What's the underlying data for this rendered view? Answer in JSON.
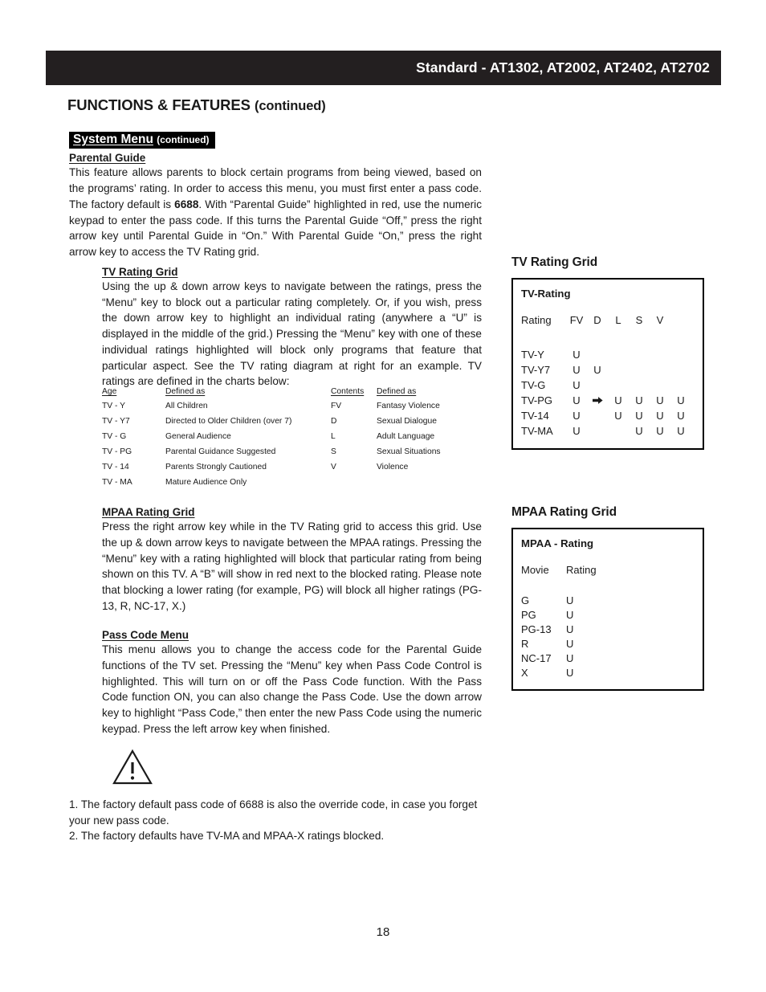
{
  "header": {
    "model_line": "Standard - AT1302, AT2002, AT2402, AT2702"
  },
  "page_title": {
    "main": "FUNCTIONS & FEATURES",
    "continued": "(continued)"
  },
  "section": {
    "badge_main": "System Menu",
    "badge_sub": "(continued)"
  },
  "parental_guide": {
    "heading": "Parental Guide",
    "paragraph": "This feature allows parents to block certain programs from being viewed, based on the programs’ rating. In order to access this menu, you must first enter a pass code. The factory default is ",
    "bold_code": "6688",
    "paragraph_rest": ". With “Parental Guide” highlighted in red, use the numeric keypad to enter the pass code. If this turns the Parental Guide “Off,” press the right arrow key until Parental Guide in “On.” With Parental Guide “On,” press the right arrow key to access the TV Rating grid."
  },
  "tv_rating_grid_text": {
    "heading": "TV Rating Grid",
    "paragraph": "Using the up & down arrow keys to navigate between the ratings, press the “Menu” key to block out a particular rating completely. Or, if you wish, press the down arrow key to highlight an individual rating (anywhere a “U” is displayed in the middle of the grid.) Pressing the “Menu” key with one of these individual ratings highlighted will block only programs that feature that particular aspect. See the TV rating diagram at right for an example. TV ratings are defined in the charts below:"
  },
  "age_chart": {
    "headers": [
      "Age",
      "Defined as"
    ],
    "rows": [
      [
        "TV - Y",
        "All Children"
      ],
      [
        "TV - Y7",
        "Directed to Older Children (over 7)"
      ],
      [
        "TV - G",
        "General Audience"
      ],
      [
        "TV - PG",
        "Parental Guidance Suggested"
      ],
      [
        "TV - 14",
        "Parents Strongly Cautioned"
      ],
      [
        "TV - MA",
        "Mature Audience Only"
      ]
    ]
  },
  "contents_chart": {
    "headers": [
      "Contents",
      "Defined as"
    ],
    "rows": [
      [
        "FV",
        "Fantasy Violence"
      ],
      [
        "D",
        "Sexual Dialogue"
      ],
      [
        "L",
        "Adult Language"
      ],
      [
        "S",
        "Sexual Situations"
      ],
      [
        "V",
        "Violence"
      ]
    ]
  },
  "mpaa_rating_grid_text": {
    "heading": "MPAA Rating Grid",
    "paragraph": "Press the right arrow key while in the TV Rating grid to access this grid. Use the up & down arrow keys to navigate between the MPAA ratings. Pressing the “Menu” key with a rating highlighted will block that particular rating from being shown on this TV. A “B” will show in red next to the blocked rating. Please note that blocking a lower rating (for example, PG) will block all higher ratings (PG-13, R, NC-17, X.)"
  },
  "pass_code_menu": {
    "heading": "Pass Code Menu",
    "paragraph": "This menu allows you to change the access code for the Parental Guide functions of the TV set. Pressing the “Menu” key when Pass Code Control is highlighted. This will turn on or off the Pass Code function. With the Pass Code function ON, you can also change the Pass Code. Use the down arrow key to highlight “Pass Code,” then enter the new Pass Code using the numeric keypad. Press the left arrow key when finished."
  },
  "notes": {
    "note1": "1. The factory default pass code of 6688 is also the override code, in case you forget your new pass code.",
    "note2": "2. The factory defaults have TV-MA and MPAA-X ratings blocked."
  },
  "tv_grid": {
    "title": "TV Rating Grid",
    "box_title": "TV-Rating",
    "column_header_label": "Rating",
    "columns": [
      "FV",
      "D",
      "L",
      "S",
      "V"
    ],
    "cursor_icon": "right-arrow-cursor-icon",
    "rows": [
      {
        "label": "TV-Y",
        "cells": [
          "U",
          "",
          "",
          "",
          ""
        ],
        "cursor_col": -1
      },
      {
        "label": "TV-Y7",
        "cells": [
          "U",
          "U",
          "",
          "",
          ""
        ],
        "cursor_col": -1
      },
      {
        "label": "TV-G",
        "cells": [
          "U",
          "",
          "",
          "",
          ""
        ],
        "cursor_col": -1
      },
      {
        "label": "TV-PG",
        "cells": [
          "U",
          "",
          "U",
          "U",
          "U",
          "U"
        ],
        "cursor_col": 1
      },
      {
        "label": "TV-14",
        "cells": [
          "U",
          "",
          "U",
          "U",
          "U",
          "U"
        ],
        "cursor_col": -1
      },
      {
        "label": "TV-MA",
        "cells": [
          "U",
          "",
          "",
          "U",
          "U",
          "U"
        ],
        "cursor_col": -1
      }
    ]
  },
  "mpaa_grid": {
    "title": "MPAA Rating Grid",
    "box_title": "MPAA - Rating",
    "col_movie": "Movie",
    "col_rating": "Rating",
    "rows": [
      {
        "movie": "G",
        "rating": "U"
      },
      {
        "movie": "PG",
        "rating": "U"
      },
      {
        "movie": "PG-13",
        "rating": "U"
      },
      {
        "movie": "R",
        "rating": "U"
      },
      {
        "movie": "NC-17",
        "rating": "U"
      },
      {
        "movie": "X",
        "rating": "U"
      }
    ]
  },
  "warning": {
    "icon": "warning-triangle-icon"
  },
  "footer": {
    "page_number": "18"
  },
  "colors": {
    "header_bar": "#231f20",
    "text": "#1a1a1a",
    "box_border": "#000000"
  }
}
